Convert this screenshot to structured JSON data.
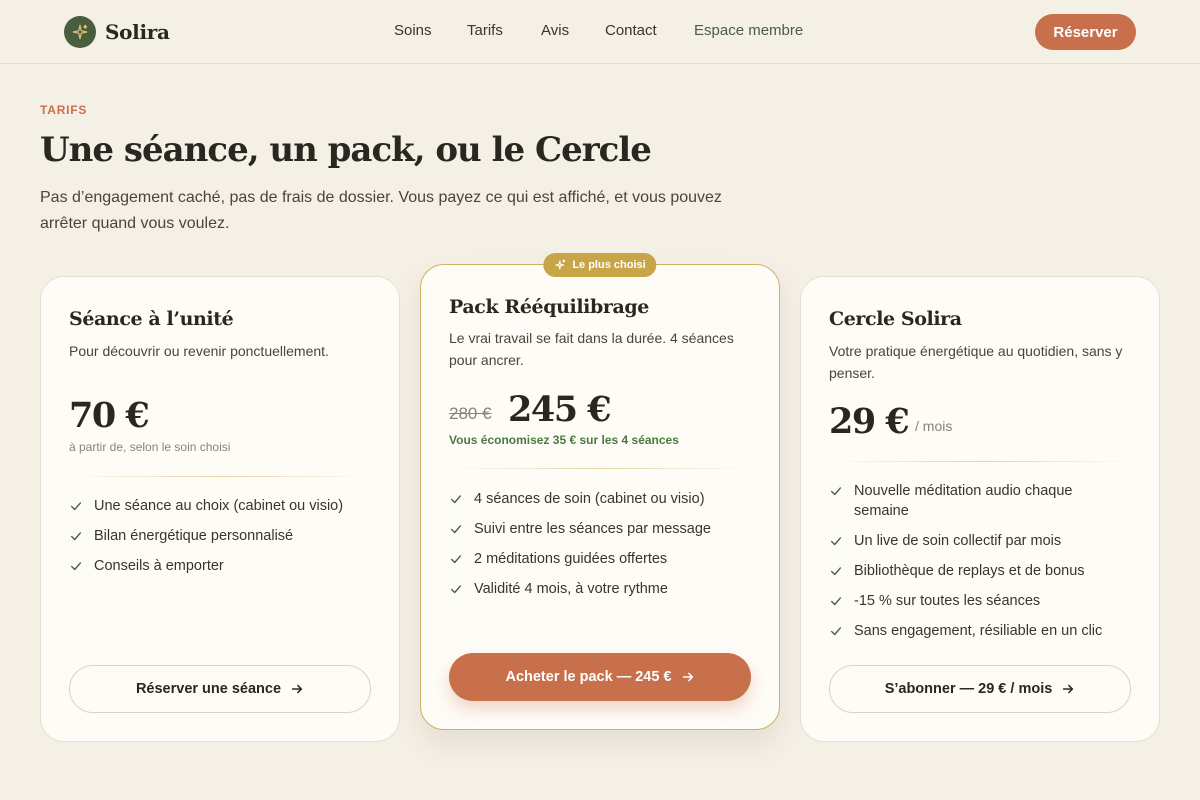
{
  "brand": {
    "name": "Solira",
    "logo_icon": "sparkle-icon",
    "logo_bg": "#4a5d3f",
    "logo_accent": "#e0c27a"
  },
  "nav": {
    "items": [
      "Soins",
      "Tarifs",
      "Avis",
      "Contact",
      "Espace membre"
    ]
  },
  "header": {
    "reserve_label": "Réserver"
  },
  "intro": {
    "eyebrow": "TARIFS",
    "title": "Une séance, un pack, ou le Cercle",
    "subtitle": "Pas d’engagement caché, pas de frais de dossier. Vous payez ce qui est affiché, et vous pouvez arrêter quand vous voulez."
  },
  "colors": {
    "accent": "#c8704b",
    "green": "#4a5d3f",
    "gold": "#c9a54a",
    "background": "#f5f0e6",
    "card": "#fefcf7"
  },
  "plans": [
    {
      "name": "Séance à l’unité",
      "description": "Pour découvrir ou revenir ponctuellement.",
      "price": "70 €",
      "price_note": "à partir de, selon le soin choisi",
      "features": [
        "Une séance au choix (cabinet ou visio)",
        "Bilan énergétique personnalisé",
        "Conseils à emporter"
      ],
      "cta": "Réserver une séance"
    },
    {
      "badge": "Le plus choisi",
      "name": "Pack Rééquilibrage",
      "description": "Le vrai travail se fait dans la durée. 4 séances pour ancrer.",
      "price_old": "280 €",
      "price": "245 €",
      "savings": "Vous économisez 35 € sur les 4 séances",
      "features": [
        "4 séances de soin (cabinet ou visio)",
        "Suivi entre les séances par message",
        "2 méditations guidées offertes",
        "Validité 4 mois, à votre rythme"
      ],
      "cta": "Acheter le pack — 245 €"
    },
    {
      "name": "Cercle Solira",
      "description": "Votre pratique énergétique au quotidien, sans y penser.",
      "price": "29 €",
      "price_unit": "/ mois",
      "features": [
        "Nouvelle méditation audio chaque semaine",
        "Un live de soin collectif par mois",
        "Bibliothèque de replays et de bonus",
        "-15 % sur toutes les séances",
        "Sans engagement, résiliable en un clic"
      ],
      "cta": "S’abonner — 29 € / mois"
    }
  ]
}
